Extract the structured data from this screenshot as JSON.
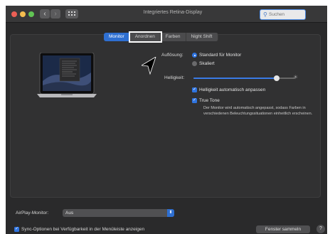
{
  "window": {
    "title": "Integriertes Retina-Display",
    "nav_back": "‹",
    "nav_forward": "›",
    "grid_icon": "grid-icon",
    "search": {
      "placeholder": "Suchen",
      "icon": "search-icon"
    }
  },
  "tabs": [
    {
      "label": "Monitor",
      "active": true
    },
    {
      "label": "Anordnen",
      "active": false
    },
    {
      "label": "Farben",
      "active": false
    },
    {
      "label": "Night Shift",
      "active": false
    }
  ],
  "resolution": {
    "label": "Auflösung:",
    "options": [
      {
        "label": "Standard für Monitor",
        "selected": true
      },
      {
        "label": "Skaliert",
        "selected": false
      }
    ]
  },
  "brightness": {
    "label": "Helligkeit:",
    "value": 0.82,
    "auto_label": "Helligkeit automatisch anpassen",
    "auto_checked": true
  },
  "true_tone": {
    "label": "True Tone",
    "checked": true,
    "description": "Der Monitor wird automatisch angepasst, sodass Farben in verschiedenen Beleuchtungssituationen einheitlich erscheinen."
  },
  "airplay": {
    "label": "AirPlay-Monitor:",
    "value": "Aus"
  },
  "footer": {
    "sync_label": "Sync-Optionen bei Verfügbarkeit in der Menüleiste anzeigen",
    "sync_checked": true,
    "collect_button": "Fenster sammeln",
    "help": "?"
  },
  "colors": {
    "accent": "#2e6fd1",
    "window_bg": "#2a2a2b",
    "close": "#ec5f55",
    "minimize": "#f4bd4f",
    "zoom": "#61c454"
  }
}
